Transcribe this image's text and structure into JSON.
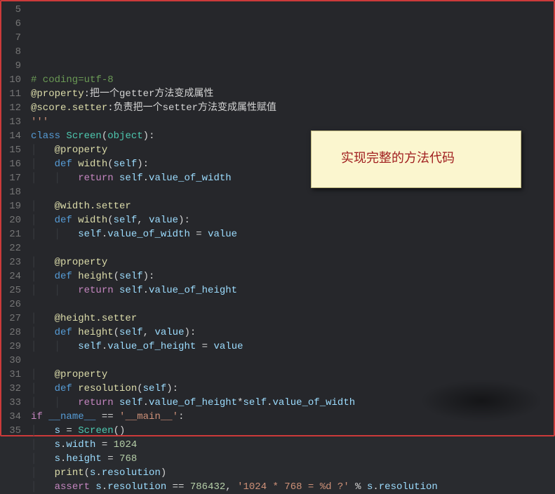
{
  "annotation_text": "实现完整的方法代码",
  "first_line_no": 5,
  "lines": [
    {
      "indent": 0,
      "tokens": []
    },
    {
      "indent": 0,
      "tokens": [
        {
          "cls": "tok-comment",
          "t": "# coding=utf-8"
        }
      ]
    },
    {
      "indent": 0,
      "tokens": [
        {
          "cls": "tok-decorator",
          "t": "@property"
        },
        {
          "cls": "tok-op",
          "t": ":把一个getter方法变成属性"
        }
      ]
    },
    {
      "indent": 0,
      "tokens": [
        {
          "cls": "tok-decorator",
          "t": "@score.setter"
        },
        {
          "cls": "tok-op",
          "t": ":负责把一个setter方法变成属性赋值"
        }
      ]
    },
    {
      "indent": 0,
      "tokens": [
        {
          "cls": "tok-string",
          "t": "'''"
        }
      ]
    },
    {
      "indent": 0,
      "tokens": [
        {
          "cls": "tok-def",
          "t": "class "
        },
        {
          "cls": "tok-class",
          "t": "Screen"
        },
        {
          "cls": "tok-op",
          "t": "("
        },
        {
          "cls": "tok-class",
          "t": "object"
        },
        {
          "cls": "tok-op",
          "t": "):"
        }
      ]
    },
    {
      "indent": 1,
      "tokens": [
        {
          "cls": "tok-decorator",
          "t": "@property"
        }
      ]
    },
    {
      "indent": 1,
      "tokens": [
        {
          "cls": "tok-def",
          "t": "def "
        },
        {
          "cls": "tok-func",
          "t": "width"
        },
        {
          "cls": "tok-op",
          "t": "("
        },
        {
          "cls": "tok-self",
          "t": "self"
        },
        {
          "cls": "tok-op",
          "t": "):"
        }
      ]
    },
    {
      "indent": 2,
      "tokens": [
        {
          "cls": "tok-keyword",
          "t": "return "
        },
        {
          "cls": "tok-self",
          "t": "self"
        },
        {
          "cls": "tok-op",
          "t": "."
        },
        {
          "cls": "tok-prop",
          "t": "value_of_width"
        }
      ]
    },
    {
      "indent": 0,
      "tokens": []
    },
    {
      "indent": 1,
      "tokens": [
        {
          "cls": "tok-decorator",
          "t": "@width.setter"
        }
      ]
    },
    {
      "indent": 1,
      "tokens": [
        {
          "cls": "tok-def",
          "t": "def "
        },
        {
          "cls": "tok-func",
          "t": "width"
        },
        {
          "cls": "tok-op",
          "t": "("
        },
        {
          "cls": "tok-self",
          "t": "self"
        },
        {
          "cls": "tok-op",
          "t": ", "
        },
        {
          "cls": "tok-param",
          "t": "value"
        },
        {
          "cls": "tok-op",
          "t": "):"
        }
      ]
    },
    {
      "indent": 2,
      "tokens": [
        {
          "cls": "tok-self",
          "t": "self"
        },
        {
          "cls": "tok-op",
          "t": "."
        },
        {
          "cls": "tok-prop",
          "t": "value_of_width"
        },
        {
          "cls": "tok-op",
          "t": " = "
        },
        {
          "cls": "tok-param",
          "t": "value"
        }
      ]
    },
    {
      "indent": 0,
      "tokens": []
    },
    {
      "indent": 1,
      "tokens": [
        {
          "cls": "tok-decorator",
          "t": "@property"
        }
      ]
    },
    {
      "indent": 1,
      "tokens": [
        {
          "cls": "tok-def",
          "t": "def "
        },
        {
          "cls": "tok-func",
          "t": "height"
        },
        {
          "cls": "tok-op",
          "t": "("
        },
        {
          "cls": "tok-self",
          "t": "self"
        },
        {
          "cls": "tok-op",
          "t": "):"
        }
      ]
    },
    {
      "indent": 2,
      "tokens": [
        {
          "cls": "tok-keyword",
          "t": "return "
        },
        {
          "cls": "tok-self",
          "t": "self"
        },
        {
          "cls": "tok-op",
          "t": "."
        },
        {
          "cls": "tok-prop",
          "t": "value_of_height"
        }
      ]
    },
    {
      "indent": 0,
      "tokens": []
    },
    {
      "indent": 1,
      "tokens": [
        {
          "cls": "tok-decorator",
          "t": "@height.setter"
        }
      ]
    },
    {
      "indent": 1,
      "tokens": [
        {
          "cls": "tok-def",
          "t": "def "
        },
        {
          "cls": "tok-func",
          "t": "height"
        },
        {
          "cls": "tok-op",
          "t": "("
        },
        {
          "cls": "tok-self",
          "t": "self"
        },
        {
          "cls": "tok-op",
          "t": ", "
        },
        {
          "cls": "tok-param",
          "t": "value"
        },
        {
          "cls": "tok-op",
          "t": "):"
        }
      ]
    },
    {
      "indent": 2,
      "tokens": [
        {
          "cls": "tok-self",
          "t": "self"
        },
        {
          "cls": "tok-op",
          "t": "."
        },
        {
          "cls": "tok-prop",
          "t": "value_of_height"
        },
        {
          "cls": "tok-op",
          "t": " = "
        },
        {
          "cls": "tok-param",
          "t": "value"
        }
      ]
    },
    {
      "indent": 0,
      "tokens": []
    },
    {
      "indent": 1,
      "tokens": [
        {
          "cls": "tok-decorator",
          "t": "@property"
        }
      ]
    },
    {
      "indent": 1,
      "tokens": [
        {
          "cls": "tok-def",
          "t": "def "
        },
        {
          "cls": "tok-func",
          "t": "resolution"
        },
        {
          "cls": "tok-op",
          "t": "("
        },
        {
          "cls": "tok-self",
          "t": "self"
        },
        {
          "cls": "tok-op",
          "t": "):"
        }
      ]
    },
    {
      "indent": 2,
      "tokens": [
        {
          "cls": "tok-keyword",
          "t": "return "
        },
        {
          "cls": "tok-self",
          "t": "self"
        },
        {
          "cls": "tok-op",
          "t": "."
        },
        {
          "cls": "tok-prop",
          "t": "value_of_height"
        },
        {
          "cls": "tok-op",
          "t": "*"
        },
        {
          "cls": "tok-self",
          "t": "self"
        },
        {
          "cls": "tok-op",
          "t": "."
        },
        {
          "cls": "tok-prop",
          "t": "value_of_width"
        }
      ]
    },
    {
      "indent": 0,
      "tokens": [
        {
          "cls": "tok-keyword",
          "t": "if "
        },
        {
          "cls": "tok-dunder",
          "t": "__name__"
        },
        {
          "cls": "tok-op",
          "t": " == "
        },
        {
          "cls": "tok-string",
          "t": "'__main__'"
        },
        {
          "cls": "tok-op",
          "t": ":"
        }
      ]
    },
    {
      "indent": 1,
      "tokens": [
        {
          "cls": "tok-param",
          "t": "s"
        },
        {
          "cls": "tok-op",
          "t": " = "
        },
        {
          "cls": "tok-class",
          "t": "Screen"
        },
        {
          "cls": "tok-op",
          "t": "()"
        }
      ]
    },
    {
      "indent": 1,
      "tokens": [
        {
          "cls": "tok-param",
          "t": "s"
        },
        {
          "cls": "tok-op",
          "t": "."
        },
        {
          "cls": "tok-prop",
          "t": "width"
        },
        {
          "cls": "tok-op",
          "t": " = "
        },
        {
          "cls": "tok-number",
          "t": "1024"
        }
      ]
    },
    {
      "indent": 1,
      "tokens": [
        {
          "cls": "tok-param",
          "t": "s"
        },
        {
          "cls": "tok-op",
          "t": "."
        },
        {
          "cls": "tok-prop",
          "t": "height"
        },
        {
          "cls": "tok-op",
          "t": " = "
        },
        {
          "cls": "tok-number",
          "t": "768"
        }
      ]
    },
    {
      "indent": 1,
      "tokens": [
        {
          "cls": "tok-builtin",
          "t": "print"
        },
        {
          "cls": "tok-op",
          "t": "("
        },
        {
          "cls": "tok-param",
          "t": "s"
        },
        {
          "cls": "tok-op",
          "t": "."
        },
        {
          "cls": "tok-prop",
          "t": "resolution"
        },
        {
          "cls": "tok-op",
          "t": ")"
        }
      ]
    },
    {
      "indent": 1,
      "tokens": [
        {
          "cls": "tok-keyword",
          "t": "assert "
        },
        {
          "cls": "tok-param",
          "t": "s"
        },
        {
          "cls": "tok-op",
          "t": "."
        },
        {
          "cls": "tok-prop",
          "t": "resolution"
        },
        {
          "cls": "tok-op",
          "t": " == "
        },
        {
          "cls": "tok-number",
          "t": "786432"
        },
        {
          "cls": "tok-op",
          "t": ", "
        },
        {
          "cls": "tok-string",
          "t": "'1024 * 768 = %d ?'"
        },
        {
          "cls": "tok-op",
          "t": " % "
        },
        {
          "cls": "tok-param",
          "t": "s"
        },
        {
          "cls": "tok-op",
          "t": "."
        },
        {
          "cls": "tok-prop",
          "t": "resolution"
        }
      ]
    }
  ]
}
